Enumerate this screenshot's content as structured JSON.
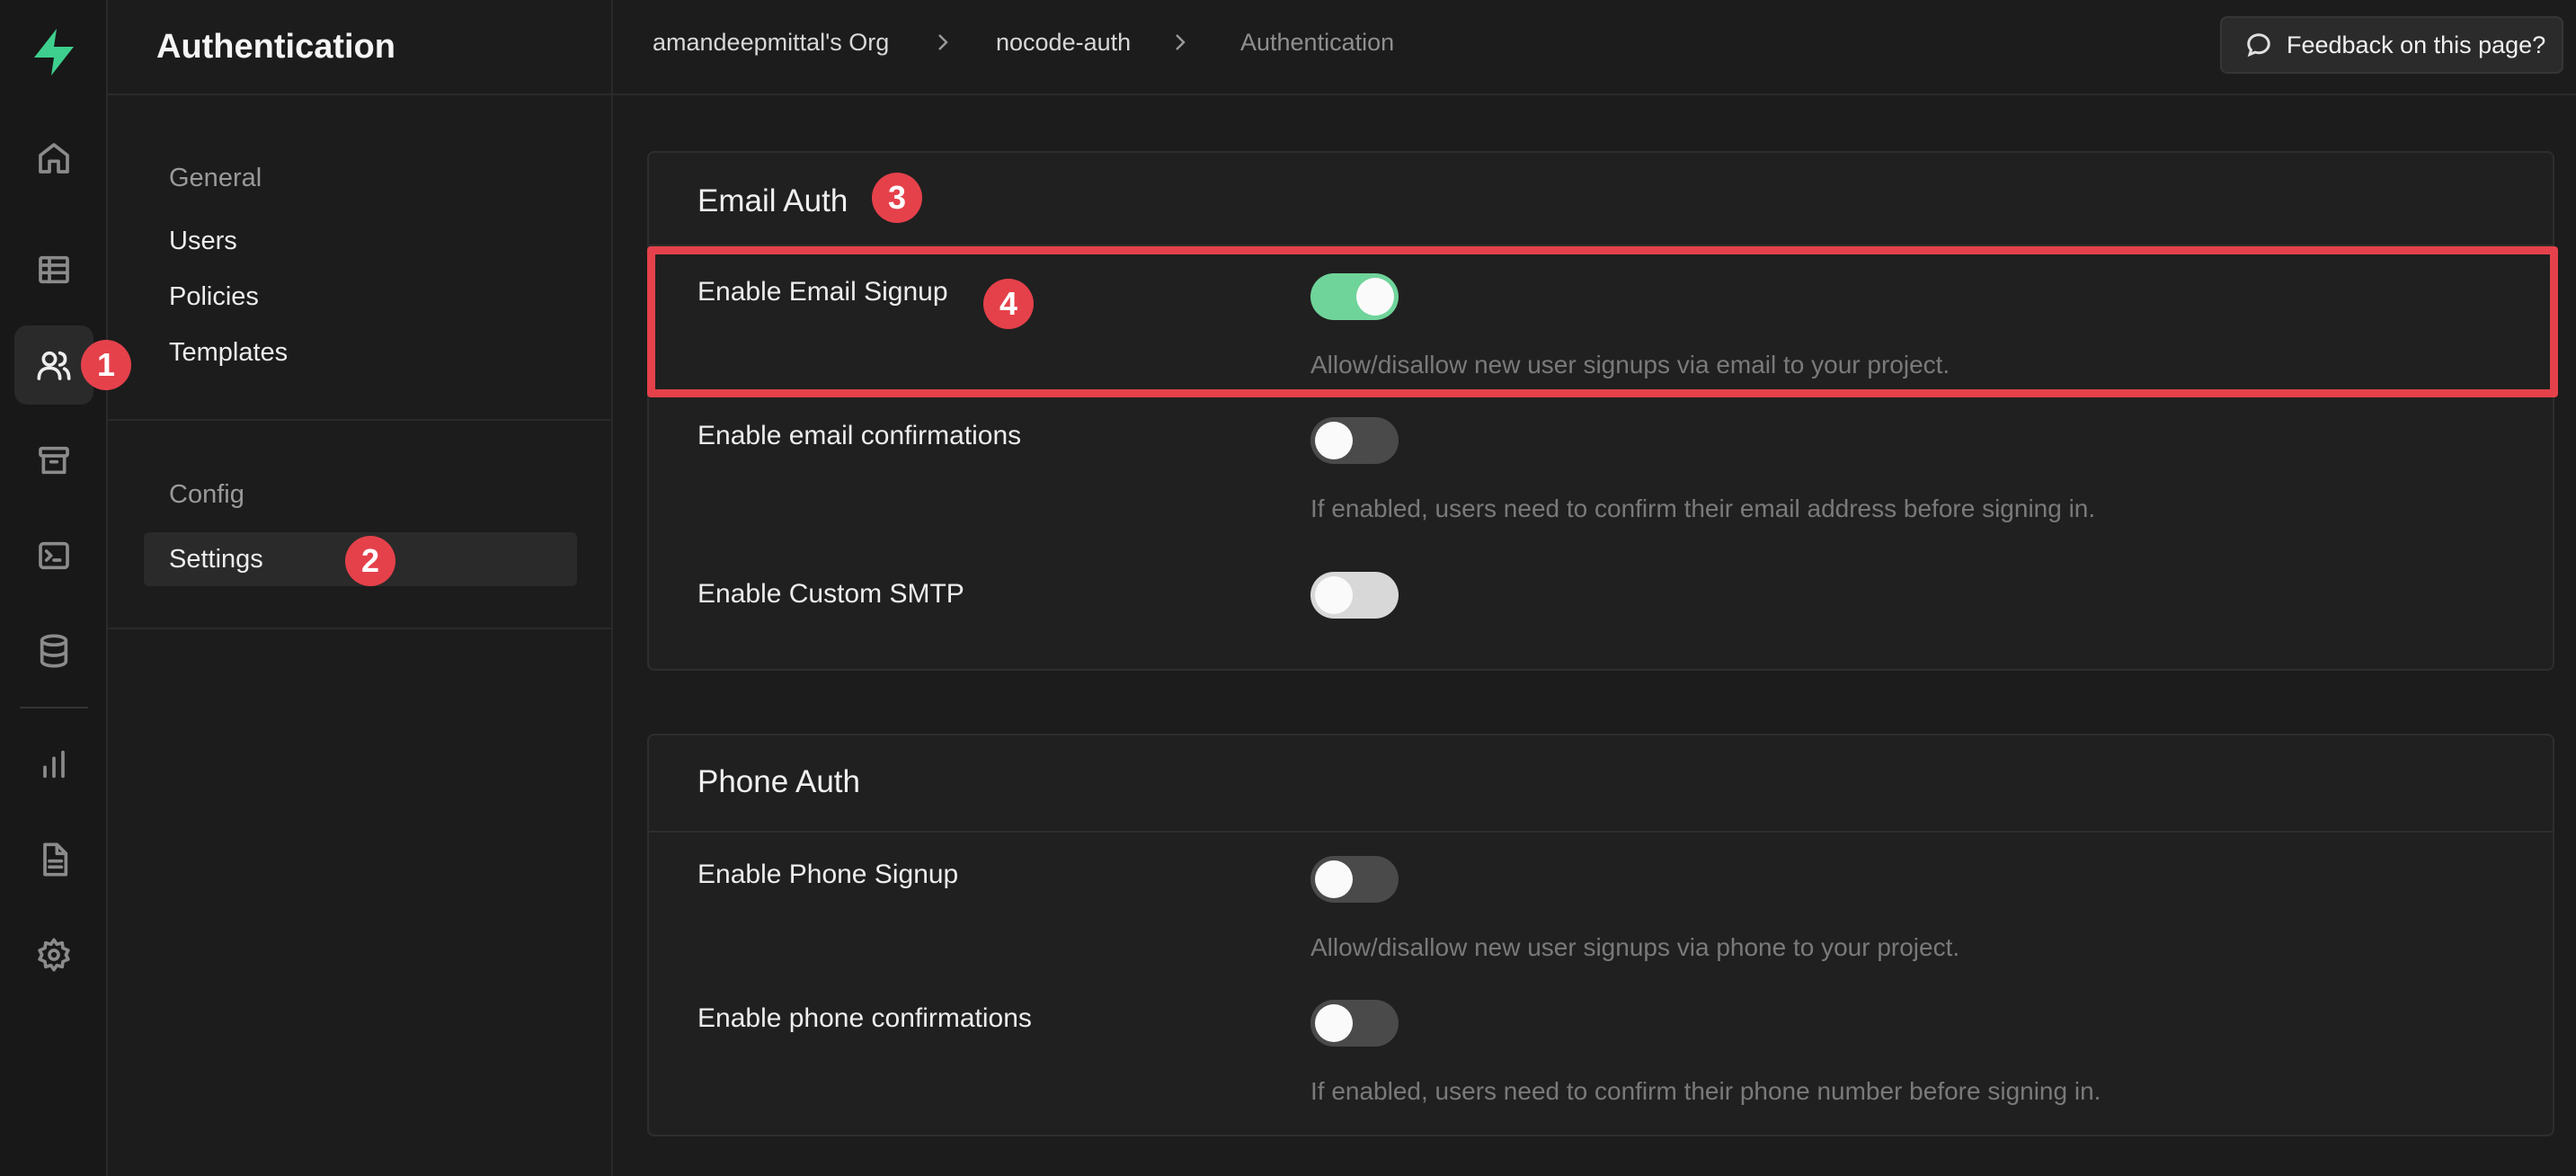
{
  "app": {
    "section_title": "Authentication"
  },
  "rail": {
    "icons": [
      "logo-icon",
      "home-icon",
      "table-editor-icon",
      "users-icon",
      "storage-icon",
      "terminal-icon",
      "database-icon",
      "reports-icon",
      "docs-icon",
      "settings-icon"
    ]
  },
  "menu": {
    "group1_title": "General",
    "group1_items": [
      "Users",
      "Policies",
      "Templates"
    ],
    "group2_title": "Config",
    "group2_items": [
      "Settings"
    ]
  },
  "breadcrumb": [
    "amandeepmittal's Org",
    "nocode-auth",
    "Authentication"
  ],
  "feedback_label": "Feedback on this page?",
  "badges": [
    "1",
    "2",
    "3",
    "4"
  ],
  "email_auth": {
    "title": "Email Auth",
    "rows": [
      {
        "label": "Enable Email Signup",
        "enabled": true,
        "description": "Allow/disallow new user signups via email to your project."
      },
      {
        "label": "Enable email confirmations",
        "enabled": false,
        "description": "If enabled, users need to confirm their email address before signing in."
      },
      {
        "label": "Enable Custom SMTP",
        "enabled": false,
        "description": ""
      }
    ]
  },
  "phone_auth": {
    "title": "Phone Auth",
    "rows": [
      {
        "label": "Enable Phone Signup",
        "enabled": false,
        "description": "Allow/disallow new user signups via phone to your project."
      },
      {
        "label": "Enable phone confirmations",
        "enabled": false,
        "description": "If enabled, users need to confirm their phone number before signing in."
      }
    ]
  },
  "colors": {
    "accent": "#6fd49a",
    "badge": "#e5414b",
    "background": "#1c1c1c"
  }
}
